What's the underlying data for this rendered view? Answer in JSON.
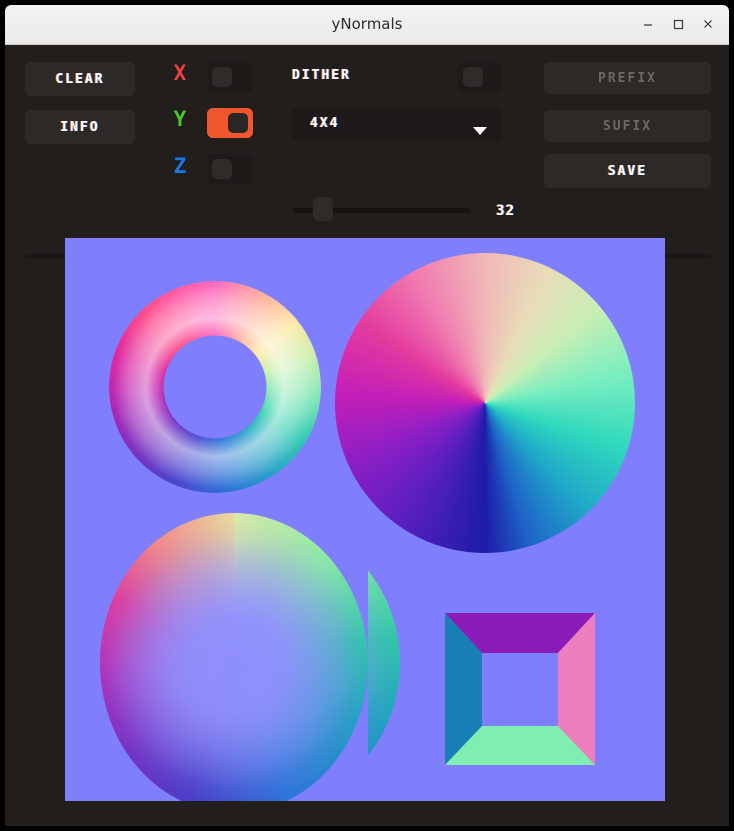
{
  "window": {
    "title": "yNormals",
    "controls": [
      {
        "name": "minimize",
        "glyph": "minimize-icon"
      },
      {
        "name": "maximize",
        "glyph": "maximize-icon"
      },
      {
        "name": "close",
        "glyph": "close-icon"
      }
    ]
  },
  "toolbar": {
    "clear_label": "CLEAR",
    "info_label": "INFO",
    "prefix_label": "PREFIX",
    "prefix_disabled": true,
    "sufix_label": "SUFIX",
    "sufix_disabled": true,
    "save_label": "SAVE",
    "dither_label": "DITHER",
    "dither_enabled": false,
    "dither_pattern": "4X4",
    "dither_pattern_options": [
      "4X4"
    ],
    "strength_value": "32",
    "axes": [
      {
        "letter": "X",
        "color": "#e8413f",
        "enabled": false
      },
      {
        "letter": "Y",
        "color": "#4cc42c",
        "enabled": true
      },
      {
        "letter": "Z",
        "color": "#1878e8",
        "enabled": false
      }
    ]
  },
  "theme": {
    "app_background": "#211e1c",
    "control_background": "#2c2927",
    "toggle_on": "#f0572c",
    "toggle_off": "#1d1a19",
    "text": "#ffffff",
    "text_disabled": "#6c6865",
    "canvas_background": "#7f7ffe"
  },
  "canvas": {
    "background": "#7f7ffe",
    "shapes": [
      {
        "name": "torus",
        "type": "normal-map-torus"
      },
      {
        "name": "cone",
        "type": "normal-map-cone"
      },
      {
        "name": "sphere",
        "type": "normal-map-sphere"
      },
      {
        "name": "pyramid",
        "type": "normal-map-inverted-pyramid",
        "faces": {
          "top": "#8b1cb8",
          "left": "#1a7fb5",
          "right": "#ee7fbe",
          "bottom": "#7feeb0",
          "center": "#7f7ffe"
        }
      }
    ]
  }
}
